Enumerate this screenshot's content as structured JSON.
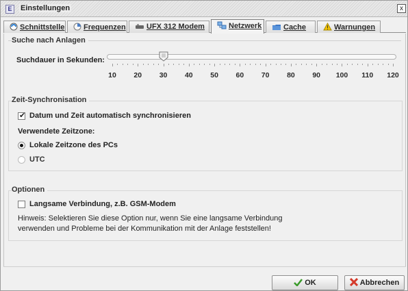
{
  "window": {
    "title": "Einstellungen",
    "icon": "settings-window-icon",
    "close_glyph": "x"
  },
  "tabs": [
    {
      "label": "Schnittstelle",
      "icon": "interface-icon",
      "active": false
    },
    {
      "label": "Frequenzen",
      "icon": "frequency-icon",
      "active": false
    },
    {
      "label": "UFX 312 Modem",
      "icon": "modem-icon",
      "active": false
    },
    {
      "label": "Netzwerk",
      "icon": "network-icon",
      "active": true
    },
    {
      "label": "Cache",
      "icon": "cache-icon",
      "active": false
    },
    {
      "label": "Warnungen",
      "icon": "warning-icon",
      "active": false
    }
  ],
  "search": {
    "group_title": "Suche nach Anlagen",
    "slider_label": "Suchdauer in Sekunden:",
    "slider_value": 30,
    "slider_min": 10,
    "slider_max": 120,
    "tick_labels": [
      "10",
      "20",
      "30",
      "40",
      "50",
      "60",
      "70",
      "80",
      "90",
      "100",
      "110",
      "120"
    ]
  },
  "time_sync": {
    "group_title": "Zeit-Synchronisation",
    "auto_sync_label": "Datum und Zeit automatisch synchronisieren",
    "auto_sync_checked": true,
    "timezone_heading": "Verwendete Zeitzone:",
    "options": [
      {
        "label": "Lokale Zeitzone des PCs",
        "selected": true
      },
      {
        "label": "UTC",
        "selected": false
      }
    ]
  },
  "options": {
    "group_title": "Optionen",
    "slow_connection_label": "Langsame Verbindung, z.B. GSM-Modem",
    "slow_connection_checked": false,
    "hint_line1": "Hinweis: Selektieren Sie diese Option nur, wenn Sie eine langsame Verbindung",
    "hint_line2": "verwenden und Probleme bei der Kommunikation mit der Anlage feststellen!"
  },
  "buttons": {
    "ok_label": "OK",
    "cancel_label": "Abbrechen"
  },
  "colors": {
    "ok_check": "#3a9a2a",
    "cancel_x": "#d43a2a",
    "warning": "#f2c200"
  }
}
